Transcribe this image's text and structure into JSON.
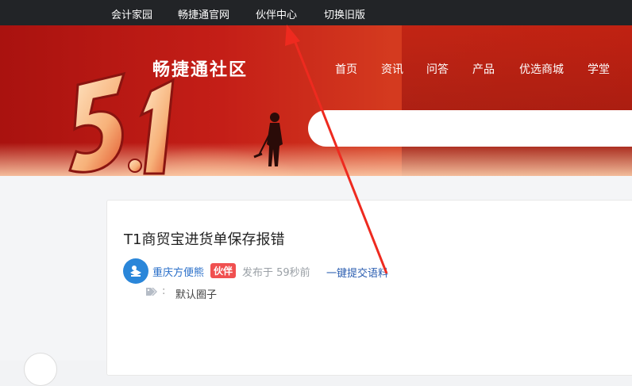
{
  "topbar": {
    "links": [
      "会计家园",
      "畅捷通官网",
      "伙伴中心",
      "切换旧版"
    ]
  },
  "banner": {
    "logo_text": "畅捷通社区",
    "nav": [
      "首页",
      "资讯",
      "问答",
      "产品",
      "优选商城",
      "学堂"
    ],
    "search_placeholder": ""
  },
  "post": {
    "title": "T1商贸宝进货单保存报错",
    "author": "重庆方便熊",
    "badge": "伙伴",
    "posted": "发布于 59秒前",
    "submit_link": "一键提交语料",
    "tag_colon": ":",
    "tag": "默认圈子"
  },
  "colors": {
    "topbar_bg": "#222427",
    "banner_red": "#c41e17",
    "badge_red": "#f05050",
    "author_blue": "#2a6fc9",
    "annotation_arrow": "#ee2a1f"
  }
}
